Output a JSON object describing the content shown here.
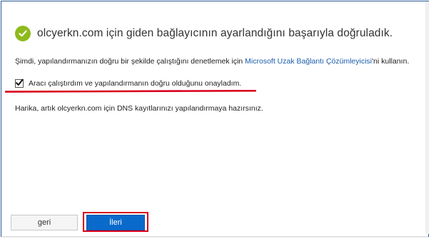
{
  "header": {
    "title": "olcyerkn.com için giden bağlayıcının ayarlandığını başarıyla doğruladık.",
    "icon": "success-check-icon",
    "icon_color": "#8dbb1b"
  },
  "instruction": {
    "prefix": "Şimdi, yapılandırmanızın doğru bir şekilde çalıştığını denetlemek için ",
    "link_text": "Microsoft Uzak Bağlantı Çözümleyicisi",
    "suffix": "'ni kullanın."
  },
  "confirm": {
    "label": "Aracı çalıştırdım ve yapılandırmanın doğru olduğunu onayladım.",
    "checked": true
  },
  "dns_text": "Harika, artık olcyerkn.com için DNS kayıtlarınızı yapılandırmaya hazırsınız.",
  "buttons": {
    "back_label": "geri",
    "next_label": "İleri"
  },
  "colors": {
    "accent": "#0a6acb",
    "link": "#1a5dab",
    "highlight": "#d9001b"
  }
}
